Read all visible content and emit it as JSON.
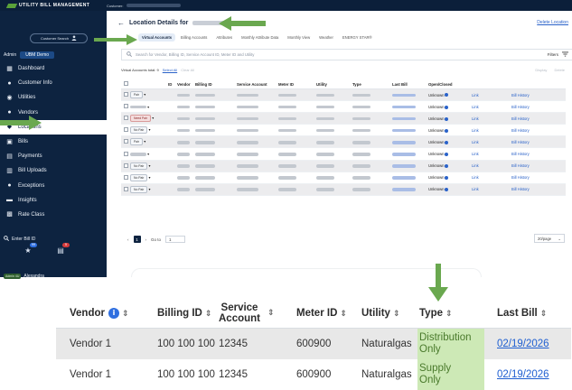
{
  "app": {
    "brand": "UTILITY BILL MANAGEMENT",
    "customer_label": "Customer:"
  },
  "sidebar": {
    "customer_search": "Customer Search",
    "admin_label": "Admin",
    "environment": "UBM Demo",
    "items": [
      {
        "label": "Dashboard",
        "icon": "grid-icon"
      },
      {
        "label": "Customer Info",
        "icon": "person-icon"
      },
      {
        "label": "Utilities",
        "icon": "bulb-icon"
      },
      {
        "label": "Vendors",
        "icon": "person-icon"
      },
      {
        "label": "Locations",
        "icon": "pin-icon",
        "active": true
      },
      {
        "label": "Bills",
        "icon": "bill-icon"
      },
      {
        "label": "Payments",
        "icon": "payment-icon"
      },
      {
        "label": "Bill Uploads",
        "icon": "upload-icon"
      },
      {
        "label": "Exceptions",
        "icon": "alert-icon"
      },
      {
        "label": "Insights",
        "icon": "insights-icon"
      },
      {
        "label": "Rate Class",
        "icon": "rate-icon"
      }
    ],
    "enter_bill_id": "Enter Bill ID",
    "badge_one": "99",
    "badge_two": "5",
    "user_tag": "Admin 4U",
    "user_name": "Alexandra"
  },
  "header": {
    "title": "Location Details for",
    "delete_link": "Delete Location"
  },
  "tabs": [
    "Virtual Accounts",
    "Billing Accounts",
    "Attributes",
    "Monthly Attribute Data",
    "Monthly View",
    "Weather",
    "ENERGY STAR®"
  ],
  "search": {
    "placeholder": "Search for Vendor, Billing ID, Service Account ID, Meter ID and Utility",
    "filters_label": "Filters"
  },
  "summary": {
    "total_label": "Virtual Accounts total: 9",
    "select_all": "Select All",
    "clear_all": "Clear All",
    "right_a": "Display",
    "right_b": "Delete"
  },
  "grid": {
    "headers": [
      "",
      "",
      "ID",
      "Vendor",
      "Billing ID",
      "Service Account",
      "Meter ID",
      "Utility",
      "Type",
      "Last Bill",
      "Open/Closed",
      "",
      ""
    ],
    "rows": [
      {
        "chip": "Pair",
        "chip_style": "normal",
        "status": "Unknown",
        "link": "Link",
        "hist": "Bill History",
        "shade": true
      },
      {
        "chip": "",
        "chip_style": "normal",
        "status": "Unknown",
        "link": "Link",
        "hist": "Bill History",
        "shade": false
      },
      {
        "chip": "Need Pair",
        "chip_style": "red",
        "status": "Unknown",
        "link": "Link",
        "hist": "Bill History",
        "shade": true
      },
      {
        "chip": "No Pair",
        "chip_style": "normal",
        "status": "Unknown",
        "link": "Link",
        "hist": "Bill History",
        "shade": false
      },
      {
        "chip": "Pair",
        "chip_style": "normal",
        "status": "Unknown",
        "link": "Link",
        "hist": "Bill History",
        "shade": true
      },
      {
        "chip": "",
        "chip_style": "normal",
        "status": "Unknown",
        "link": "Link",
        "hist": "Bill History",
        "shade": false
      },
      {
        "chip": "No Pair",
        "chip_style": "normal",
        "status": "Unknown",
        "link": "Link",
        "hist": "Bill History",
        "shade": true
      },
      {
        "chip": "No Pair",
        "chip_style": "normal",
        "status": "Unknown",
        "link": "Link",
        "hist": "Bill History",
        "shade": false
      },
      {
        "chip": "No Pair",
        "chip_style": "normal",
        "status": "Unknown",
        "link": "Link",
        "hist": "Bill History",
        "shade": true
      }
    ]
  },
  "pager": {
    "current": "1",
    "goto_label": "Go to",
    "goto_value": "1",
    "per_page": "20/page"
  },
  "zoom": {
    "headers": {
      "vendor": "Vendor",
      "billing_id": "Billing ID",
      "service_account_1": "Service",
      "service_account_2": "Account",
      "meter_id": "Meter ID",
      "utility": "Utility",
      "type": "Type",
      "last_bill": "Last Bill"
    },
    "rows": [
      {
        "vendor": "Vendor 1",
        "billing_id": "100 100 100",
        "service_account": "12345",
        "meter_id": "600900",
        "utility": "Naturalgas",
        "type_1": "Distribution",
        "type_2": "Only",
        "last_bill": "02/19/2026"
      },
      {
        "vendor": "Vendor 1",
        "billing_id": "100 100 100",
        "service_account": "12345",
        "meter_id": "600900",
        "utility": "Naturalgas",
        "type_1": "Supply",
        "type_2": "Only",
        "last_bill": "02/19/2026"
      }
    ]
  },
  "colors": {
    "sidebar": "#0d2340",
    "accent_green": "#5aa13a",
    "highlight": "#cde9b6",
    "link": "#1f5fd1"
  }
}
